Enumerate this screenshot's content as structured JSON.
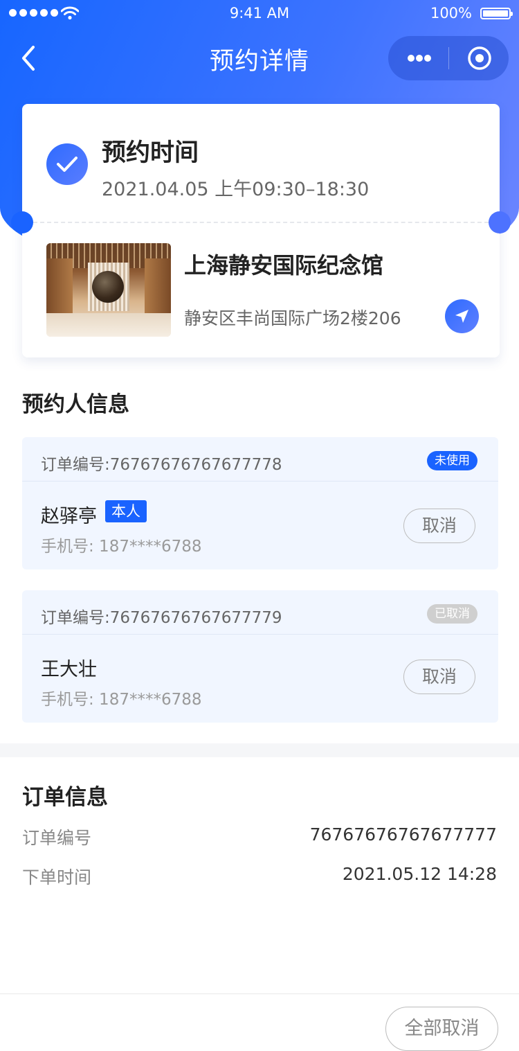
{
  "status_bar": {
    "time": "9:41 AM",
    "battery": "100%"
  },
  "nav": {
    "title": "预约详情"
  },
  "reservation": {
    "title": "预约时间",
    "time": "2021.04.05 上午09:30–18:30",
    "venue_name": "上海静安国际纪念馆",
    "venue_address": "静安区丰尚国际广场2楼206"
  },
  "attendees": {
    "section_title": "预约人信息",
    "items": [
      {
        "order_no": "订单编号:76767676767677778",
        "status": "未使用",
        "name": "赵驿亭",
        "self_tag": "本人",
        "phone": "手机号: 187****6788",
        "cancel_label": "取消"
      },
      {
        "order_no": "订单编号:76767676767677779",
        "status": "已取消",
        "name": "王大壮",
        "phone": "手机号: 187****6788",
        "cancel_label": "取消"
      }
    ]
  },
  "order_info": {
    "section_title": "订单信息",
    "order_no_label": "订单编号",
    "order_no_value": "76767676767677777",
    "order_time_label": "下单时间",
    "order_time_value": "2021.05.12 14:28"
  },
  "footer": {
    "cancel_all_label": "全部取消"
  },
  "colors": {
    "primary": "#1a63ff",
    "cancelled_tag": "#cfcfcf",
    "card_bg": "#f1f6ff"
  }
}
